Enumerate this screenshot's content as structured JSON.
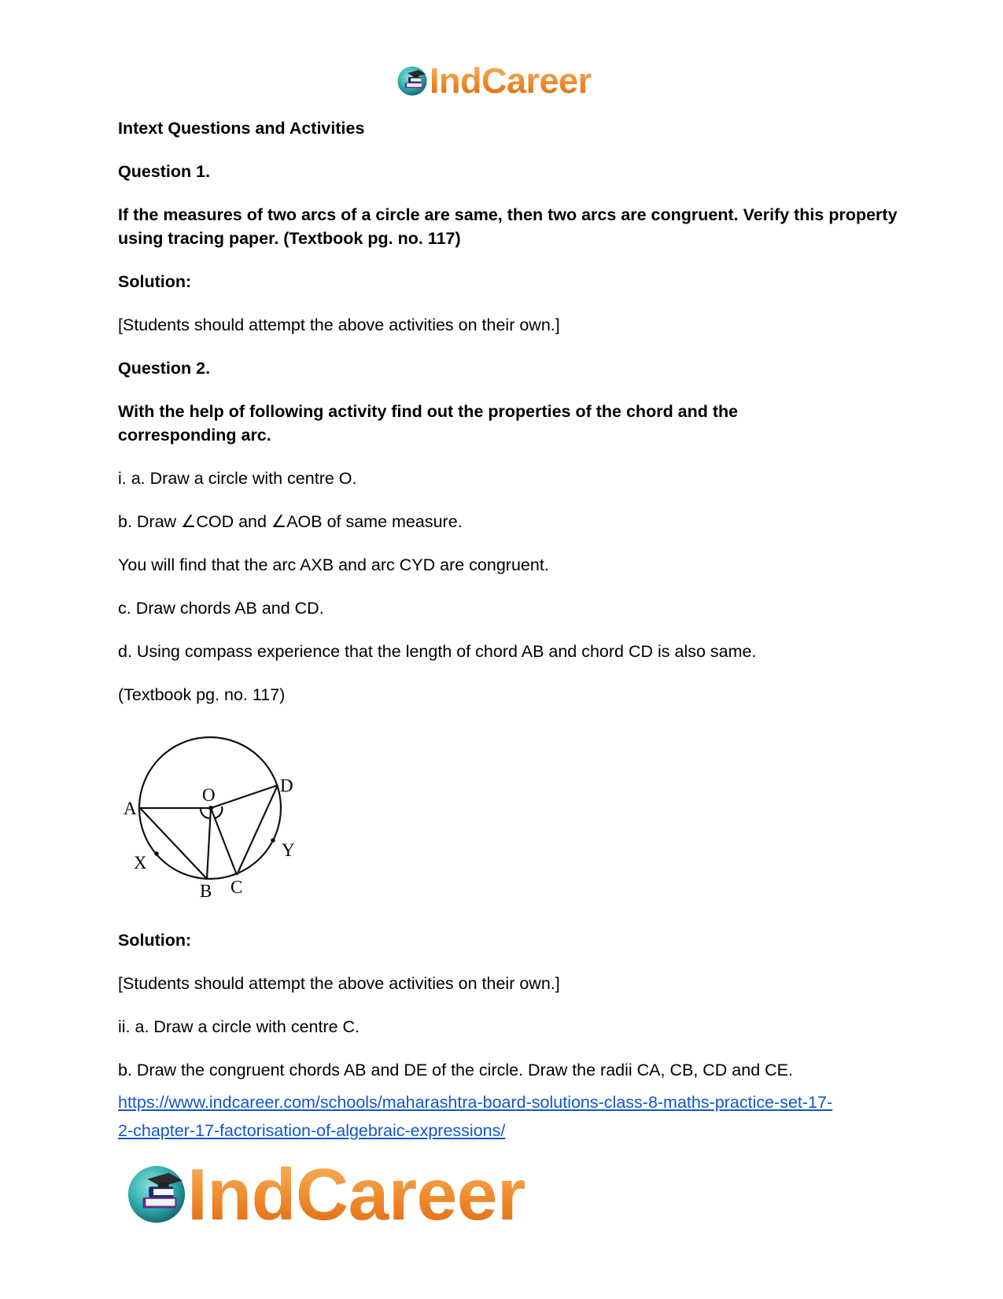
{
  "header": {
    "logo_icon": "graduation-books-icon",
    "logo_text": "IndCareer"
  },
  "content": {
    "section_title": "Intext Questions and Activities",
    "q1": {
      "label": "Question 1.",
      "text": "If the measures of two arcs of a circle are same, then two arcs are congruent. Verify this property using tracing paper. (Textbook pg. no. 117)",
      "solution_label": "Solution:",
      "solution_text": "[Students should attempt the above activities on their own.]"
    },
    "q2": {
      "label": "Question 2.",
      "text": "With the help of following activity find out the properties of the chord and the corresponding arc.",
      "steps": [
        "i. a. Draw a circle with centre O.",
        "b. Draw ∠COD and ∠AOB of same measure.",
        "You will find that the arc AXB and arc CYD are congruent.",
        "c. Draw chords AB and CD.",
        "d. Using compass experience that the length of chord AB and chord CD is also same.",
        "(Textbook pg. no. 117)"
      ],
      "figure": {
        "labels": {
          "A": "A",
          "B": "B",
          "C": "C",
          "D": "D",
          "O": "O",
          "X": "X",
          "Y": "Y"
        }
      },
      "solution_label": "Solution:",
      "solution_text": "[Students should attempt the above activities on their own.]",
      "steps_ii": [
        "ii. a. Draw a circle with centre C.",
        "b. Draw the congruent chords AB and DE of the circle. Draw the radii CA, CB, CD and CE."
      ]
    },
    "link": {
      "line1": "https://www.indcareer.com/schools/maharashtra-board-solutions-class-8-maths-practice-set-17-",
      "line2": "2-chapter-17-factorisation-of-algebraic-expressions/"
    }
  },
  "footer": {
    "logo_icon": "graduation-books-icon",
    "logo_text": "IndCareer"
  },
  "colors": {
    "brand_orange": "#ee8a2c",
    "link_blue": "#1155cc",
    "logo_teal": "#3fb9b8"
  }
}
